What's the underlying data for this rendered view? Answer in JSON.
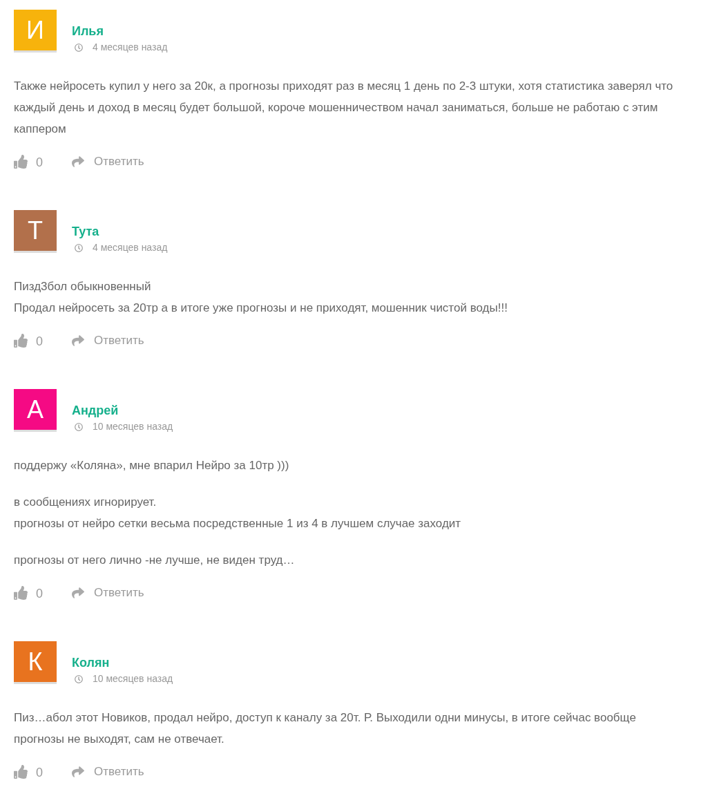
{
  "comments": [
    {
      "initial": "И",
      "color": "#f7b30c",
      "author": "Илья",
      "time": "4 месяцев назад",
      "paragraphs": [
        "Также нейросеть купил у него за 20к, а прогнозы приходят раз в месяц 1 день по 2-3 штуки, хотя статистика заверял что каждый день и доход в месяц будет большой, короче мошенничеством начал заниматься, больше не работаю с этим каппером"
      ],
      "likes": "0",
      "reply": "Ответить"
    },
    {
      "initial": "Т",
      "color": "#b2704b",
      "author": "Тута",
      "time": "4 месяцев назад",
      "paragraphs": [
        "Пизд3бол обыкновенный\nПродал нейросеть за 20тр а в итоге уже прогнозы и не приходят, мошенник чистой воды!!!"
      ],
      "likes": "0",
      "reply": "Ответить"
    },
    {
      "initial": "А",
      "color": "#f50a84",
      "author": "Андрей",
      "time": "10 месяцев назад",
      "paragraphs": [
        "поддержу «Коляна», мне впарил Нейро за 10тр )))",
        "в сообщениях игнорирует.\nпрогнозы от нейро сетки весьма посредственные 1 из 4 в лучшем случае заходит",
        "прогнозы от него лично -не лучше, не виден труд…"
      ],
      "likes": "0",
      "reply": "Ответить"
    },
    {
      "initial": "К",
      "color": "#e8731f",
      "author": "Колян",
      "time": "10 месяцев назад",
      "paragraphs": [
        "Пиз…абол этот Новиков, продал нейро, доступ к каналу за 20т. Р. Выходили одни минусы, в итоге сейчас вообще прогнозы не выходят, сам не отвечает."
      ],
      "likes": "0",
      "reply": "Ответить"
    }
  ]
}
